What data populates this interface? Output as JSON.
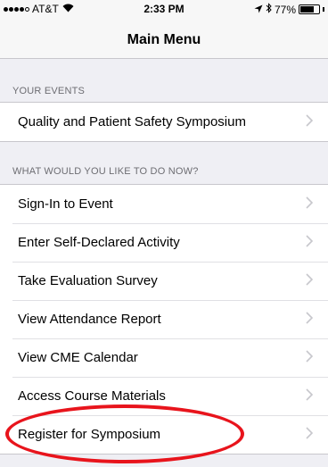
{
  "statusbar": {
    "carrier": "AT&T",
    "time": "2:33 PM",
    "battery": "77%",
    "battery_level": 0.77
  },
  "nav": {
    "title": "Main Menu"
  },
  "your_events": {
    "header": "YOUR EVENTS",
    "items": [
      {
        "label": "Quality and Patient Safety Symposium"
      }
    ]
  },
  "actions": {
    "header": "WHAT WOULD YOU LIKE TO DO NOW?",
    "items": [
      {
        "label": "Sign-In to Event"
      },
      {
        "label": "Enter Self-Declared Activity"
      },
      {
        "label": "Take Evaluation Survey"
      },
      {
        "label": "View Attendance Report"
      },
      {
        "label": "View CME Calendar"
      },
      {
        "label": "Access Course Materials"
      },
      {
        "label": "Register for Symposium"
      }
    ]
  },
  "colors": {
    "background": "#efeff4",
    "annotation": "#e8141c",
    "chevron": "#c7c7cc",
    "section_header": "#6d6d72"
  },
  "icons": [
    "signal-dots-icon",
    "wifi-icon",
    "location-arrow-icon",
    "bluetooth-icon",
    "battery-icon",
    "chevron-right-icon"
  ]
}
